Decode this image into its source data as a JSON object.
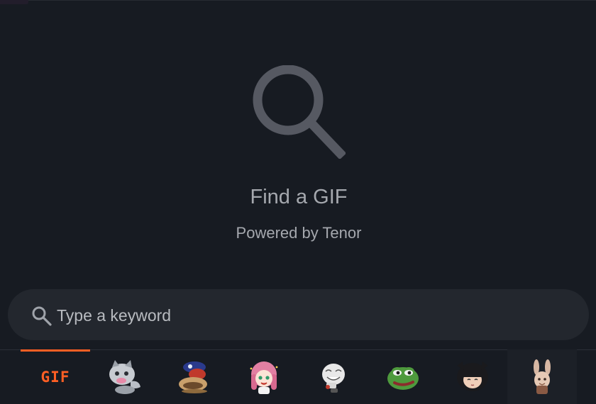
{
  "empty_state": {
    "title": "Find a GIF",
    "subtitle": "Powered by Tenor",
    "icon": "search-icon"
  },
  "search": {
    "placeholder": "Type a keyword",
    "value": "",
    "icon": "search-icon"
  },
  "tray": {
    "active_color": "#ff5f24",
    "items": [
      {
        "name": "gif-tab",
        "label": "GIF",
        "active": true
      },
      {
        "name": "sticker-cat-face",
        "label": ""
      },
      {
        "name": "sticker-sleeping-figure",
        "label": ""
      },
      {
        "name": "sticker-anime-girl-pink",
        "label": ""
      },
      {
        "name": "sticker-troll-face",
        "label": ""
      },
      {
        "name": "sticker-pepe-frog",
        "label": ""
      },
      {
        "name": "sticker-anime-girl-dark-hair",
        "label": ""
      },
      {
        "name": "sticker-bunny-ears",
        "label": ""
      }
    ]
  },
  "colors": {
    "background": "#171b22",
    "search_bar": "#23272e",
    "text_muted": "#a5a8ae",
    "accent": "#ff5f24"
  }
}
